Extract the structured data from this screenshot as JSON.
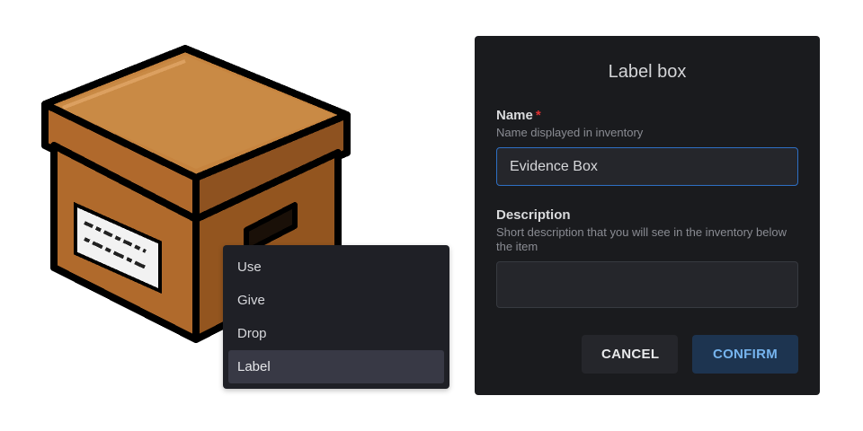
{
  "item_image": {
    "icon": "cardboard-box-icon"
  },
  "context_menu": {
    "items": [
      {
        "label": "Use"
      },
      {
        "label": "Give"
      },
      {
        "label": "Drop"
      },
      {
        "label": "Label",
        "selected": true
      }
    ]
  },
  "dialog": {
    "title": "Label box",
    "name_field": {
      "label": "Name",
      "required_marker": "*",
      "description": "Name displayed in inventory",
      "value": "Evidence Box"
    },
    "description_field": {
      "label": "Description",
      "description": "Short description that you will see in the inventory below the item",
      "value": ""
    },
    "cancel_label": "CANCEL",
    "confirm_label": "CONFIRM"
  },
  "colors": {
    "dialog_bg": "#1a1b1e",
    "menu_bg": "#1f2026",
    "accent_border": "#2e6fc4",
    "confirm_text": "#76b4ee",
    "required": "#e03131",
    "box_brown": "#c27c3e"
  }
}
